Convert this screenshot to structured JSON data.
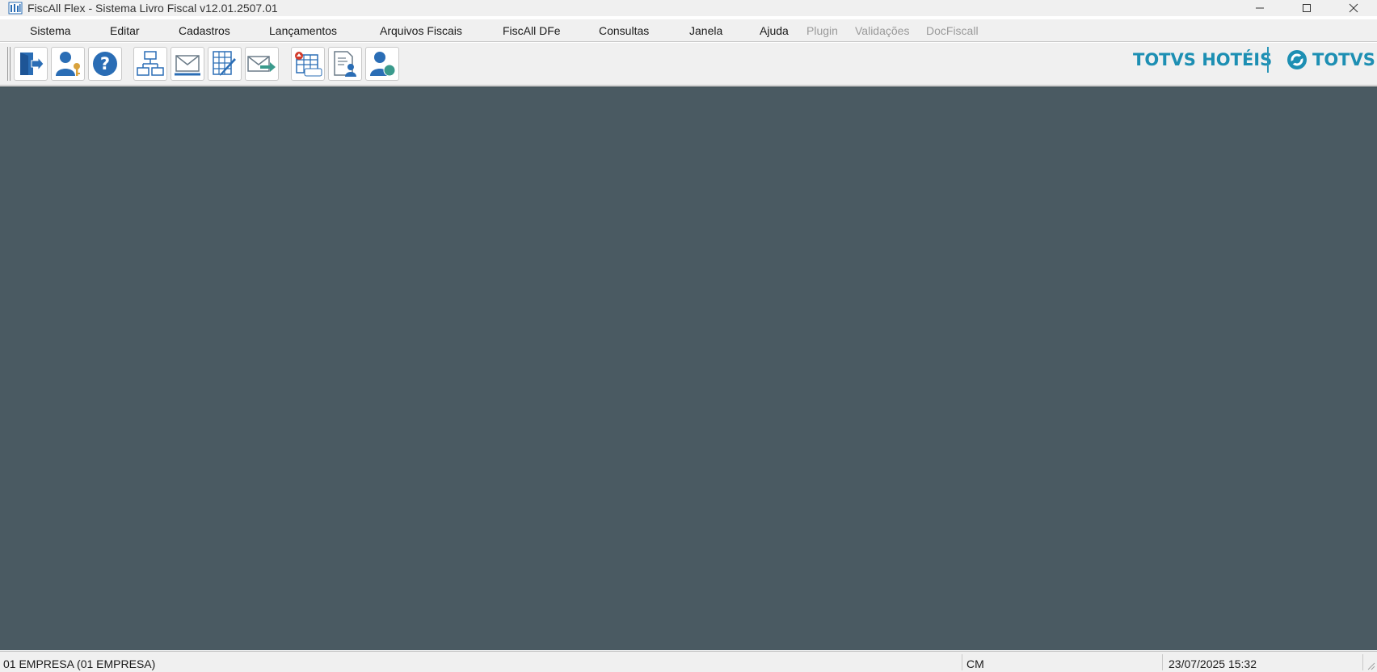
{
  "window": {
    "title": "FiscAll Flex - Sistema Livro Fiscal v12.01.2507.01",
    "app_icon": "fiscall-app-icon",
    "controls": [
      "minimize-icon",
      "maximize-icon",
      "close-icon"
    ]
  },
  "menu": {
    "items": [
      {
        "label": "Sistema",
        "enabled": true
      },
      {
        "label": "Editar",
        "enabled": true
      },
      {
        "label": "Cadastros",
        "enabled": true
      },
      {
        "label": "Lançamentos",
        "enabled": true
      },
      {
        "label": "Arquivos Fiscais",
        "enabled": true
      },
      {
        "label": "FiscAll DFe",
        "enabled": true
      },
      {
        "label": "Consultas",
        "enabled": true
      },
      {
        "label": "Janela",
        "enabled": true
      },
      {
        "label": "Ajuda",
        "enabled": true
      },
      {
        "label": "Plugin",
        "enabled": false
      },
      {
        "label": "Validações",
        "enabled": false
      },
      {
        "label": "DocFiscall",
        "enabled": false
      }
    ]
  },
  "toolbar": {
    "buttons": [
      {
        "icon": "exit-door-icon"
      },
      {
        "icon": "user-key-icon"
      },
      {
        "icon": "help-question-icon"
      },
      {
        "icon": "org-chart-icon"
      },
      {
        "icon": "envelope-icon"
      },
      {
        "icon": "spreadsheet-edit-icon"
      },
      {
        "icon": "send-mail-icon"
      },
      {
        "icon": "icms-table-icon"
      },
      {
        "icon": "document-user-icon"
      },
      {
        "icon": "user-money-icon"
      }
    ]
  },
  "branding": {
    "product": "TOTVS HOTÉIS",
    "company": "TOTVS",
    "color": "#1d8fb3"
  },
  "colors": {
    "workspace": "#4a5a62",
    "icon_blue": "#2a6db5"
  },
  "status": {
    "company": "01 EMPRESA (01 EMPRESA)",
    "mode": "CM",
    "datetime": "23/07/2025 15:32"
  }
}
